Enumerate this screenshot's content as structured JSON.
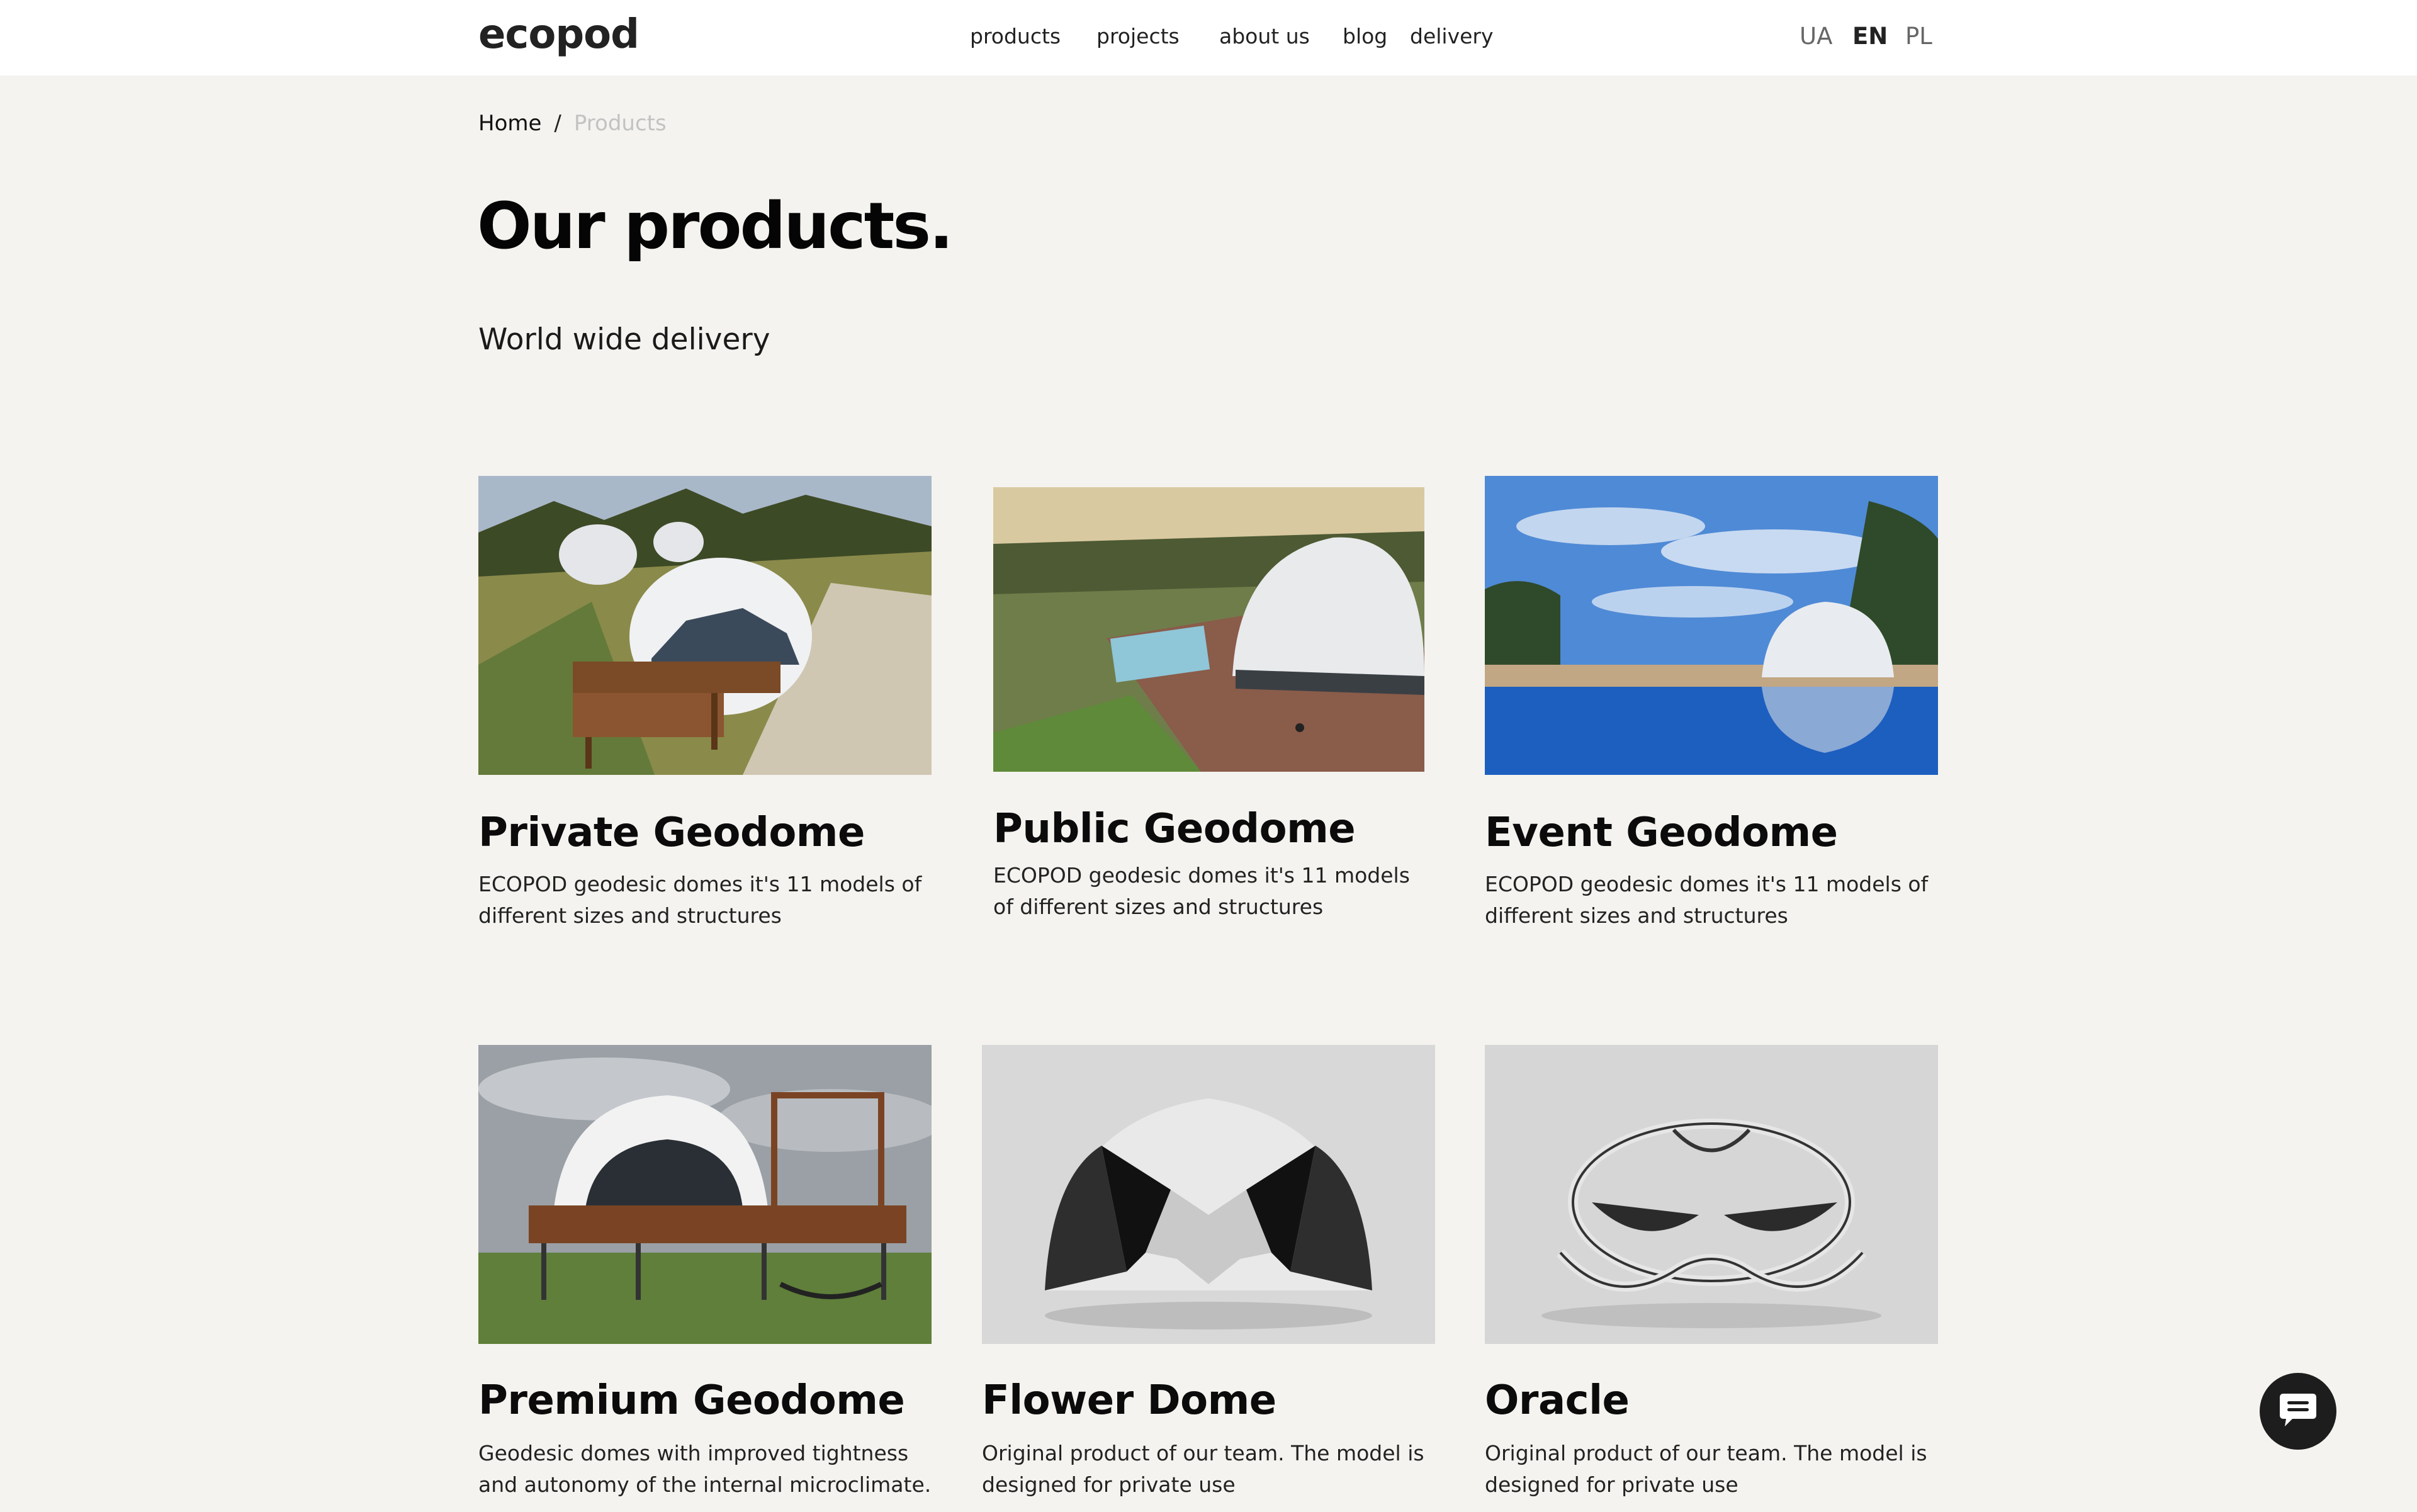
{
  "header": {
    "logo": "ecopod",
    "nav": [
      {
        "label": "products"
      },
      {
        "label": "projects"
      },
      {
        "label": "about us"
      },
      {
        "label": "blog"
      },
      {
        "label": "delivery"
      }
    ],
    "languages": [
      {
        "label": "UA",
        "active": false
      },
      {
        "label": "EN",
        "active": true
      },
      {
        "label": "PL",
        "active": false
      }
    ]
  },
  "breadcrumb": {
    "home": "Home",
    "separator": "/",
    "current": "Products"
  },
  "page": {
    "title": "Our products.",
    "subtitle": "World wide delivery"
  },
  "products": [
    {
      "title": "Private Geodome",
      "description": "ECOPOD geodesic domes it's 11 models of different sizes and structures",
      "image": "private-geodome-photo"
    },
    {
      "title": "Public Geodome",
      "description": "ECOPOD geodesic domes it's 11 models of different sizes and structures",
      "image": "public-geodome-photo"
    },
    {
      "title": "Event Geodome",
      "description": "ECOPOD geodesic domes it's 11 models of different sizes and structures",
      "image": "event-geodome-photo"
    },
    {
      "title": "Premium Geodome",
      "description": "Geodesic domes with improved tightness and autonomy of the internal microclimate.",
      "image": "premium-geodome-photo"
    },
    {
      "title": "Flower Dome",
      "description": "Original product of our team. The model is designed for private use",
      "image": "flower-dome-render"
    },
    {
      "title": "Oracle",
      "description": "Original product of our team. The model is designed for private use",
      "image": "oracle-render"
    }
  ],
  "chat": {
    "icon": "chat-bubble-icon"
  },
  "colors": {
    "background": "#f4f3ef",
    "header": "#ffffff",
    "text": "#111111",
    "muted": "#c2c2c2",
    "chat_button": "#1d1d1d"
  }
}
